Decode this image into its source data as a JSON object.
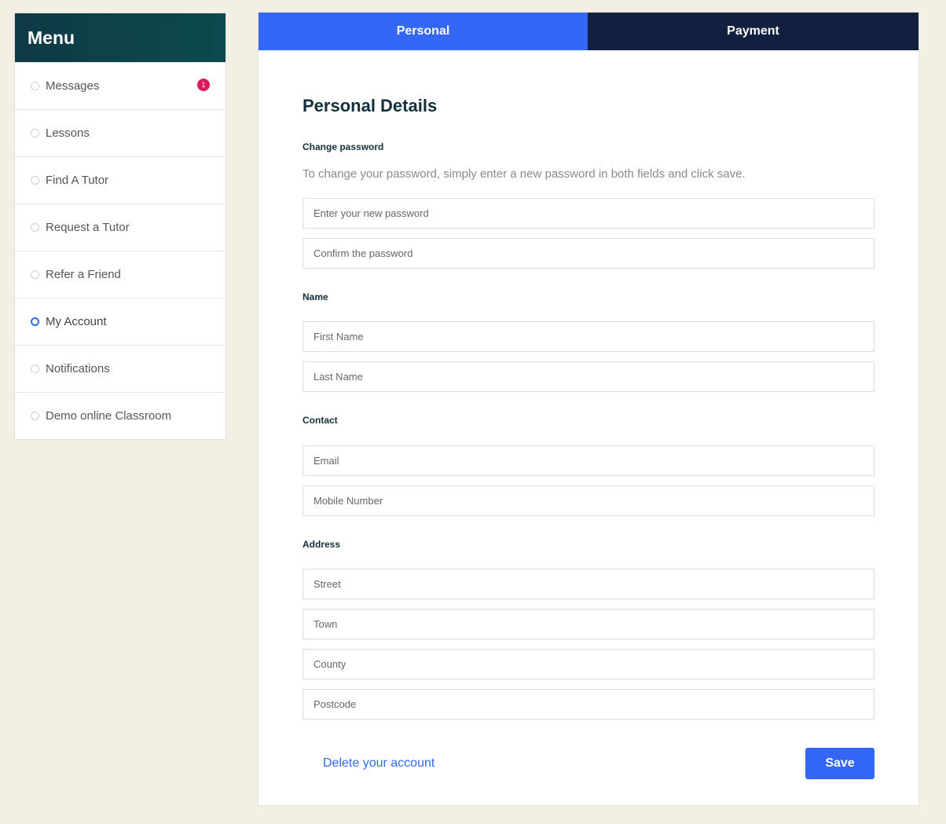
{
  "sidebar": {
    "title": "Menu",
    "items": [
      {
        "label": "Messages",
        "badge": "1"
      },
      {
        "label": "Lessons"
      },
      {
        "label": "Find A Tutor"
      },
      {
        "label": "Request a Tutor"
      },
      {
        "label": "Refer a Friend"
      },
      {
        "label": "My Account",
        "active": true
      },
      {
        "label": "Notifications"
      },
      {
        "label": "Demo online Classroom"
      }
    ]
  },
  "tabs": {
    "personal": "Personal",
    "payment": "Payment"
  },
  "form": {
    "title": "Personal Details",
    "password": {
      "label": "Change password",
      "help": "To change your password, simply enter a new password in both fields and click save.",
      "new_placeholder": "Enter your new password",
      "confirm_placeholder": "Confirm the password"
    },
    "name": {
      "label": "Name",
      "first_placeholder": "First Name",
      "last_placeholder": "Last Name"
    },
    "contact": {
      "label": "Contact",
      "email_placeholder": "Email",
      "mobile_placeholder": "Mobile Number"
    },
    "address": {
      "label": "Address",
      "street_placeholder": "Street",
      "town_placeholder": "Town",
      "county_placeholder": "County",
      "postcode_placeholder": "Postcode"
    },
    "delete_label": "Delete your account",
    "save_label": "Save"
  },
  "colors": {
    "background": "#f3efe4",
    "sidebar_header": "#0e3a46",
    "accent": "#3467f5",
    "tab_dark": "#12203f",
    "badge": "#d81b60"
  }
}
